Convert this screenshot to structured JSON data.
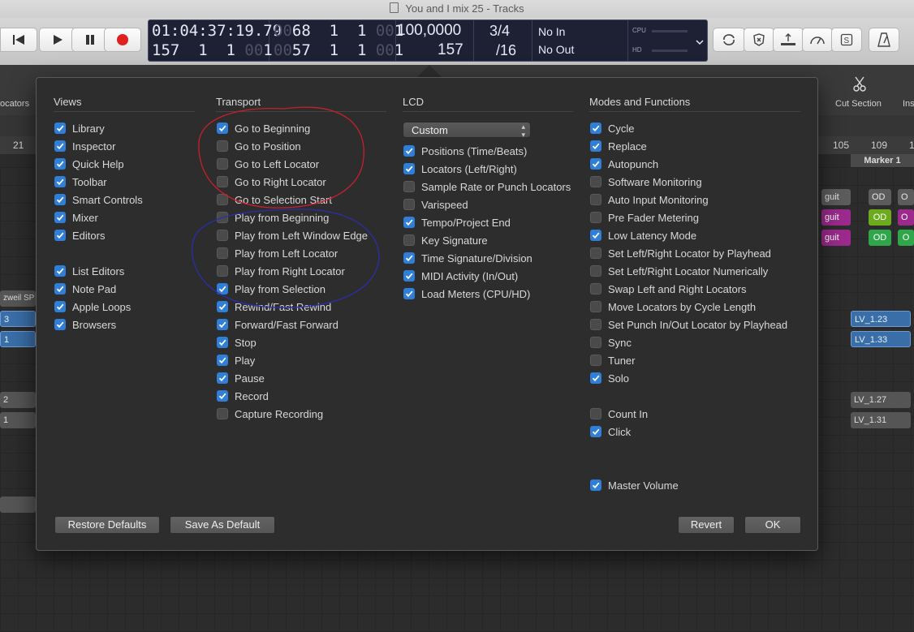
{
  "window": {
    "title": "You and I mix 25 - Tracks"
  },
  "lcd": {
    "time": "01:04:37:19.79",
    "time_dim_1": "00",
    "bars_top": "68  1  1",
    "bars_top_dim": "00",
    "bars_top_tail": "1",
    "row2_left": "157  1  1",
    "row2_left_dim": "00",
    "row2_left_tail": "1",
    "row2_mid_dim": "00",
    "row2_mid": "57  1  1",
    "row2_mid_dim2": "00",
    "row2_mid_tail": "1",
    "row1_dim_left": "00",
    "row1_dim_tail": "00",
    "tempo": "100,0000",
    "tempo_sub": "157",
    "sig_top": "3/4",
    "sig_bottom": "/16",
    "midi_in": "No In",
    "midi_out": "No Out",
    "cpu_label": "CPU",
    "hd_label": "HD"
  },
  "subtoolbar": {
    "left_label": "ocators",
    "cut_section": "Cut Section",
    "ins_label": "Ins"
  },
  "ruler": {
    "n21": "21",
    "n105": "105",
    "n109": "109",
    "n1": "1"
  },
  "arrange": {
    "marker": "Marker 1",
    "zweil": "zweil SP",
    "guit": "guit",
    "od": "OD",
    "o": "O",
    "lv123": "LV_1.23",
    "lv133": "LV_1.33",
    "lv127": "LV_1.27",
    "lv131": "LV_1.31",
    "left_3": "3",
    "left_1": "1",
    "left_2": "2"
  },
  "dialog": {
    "views": {
      "heading": "Views",
      "items": [
        {
          "label": "Library",
          "checked": true
        },
        {
          "label": "Inspector",
          "checked": true
        },
        {
          "label": "Quick Help",
          "checked": true
        },
        {
          "label": "Toolbar",
          "checked": true
        },
        {
          "label": "Smart Controls",
          "checked": true
        },
        {
          "label": "Mixer",
          "checked": true
        },
        {
          "label": "Editors",
          "checked": true
        },
        {
          "label": "List Editors",
          "checked": true
        },
        {
          "label": "Note Pad",
          "checked": true
        },
        {
          "label": "Apple Loops",
          "checked": true
        },
        {
          "label": "Browsers",
          "checked": true
        }
      ]
    },
    "transport": {
      "heading": "Transport",
      "items": [
        {
          "label": "Go to Beginning",
          "checked": true
        },
        {
          "label": "Go to Position",
          "checked": false
        },
        {
          "label": "Go to Left Locator",
          "checked": false
        },
        {
          "label": "Go to Right Locator",
          "checked": false
        },
        {
          "label": "Go to Selection Start",
          "checked": false
        },
        {
          "label": "Play from Beginning",
          "checked": false
        },
        {
          "label": "Play from Left Window Edge",
          "checked": false
        },
        {
          "label": "Play from Left Locator",
          "checked": false
        },
        {
          "label": "Play from Right Locator",
          "checked": false
        },
        {
          "label": "Play from Selection",
          "checked": true
        },
        {
          "label": "Rewind/Fast Rewind",
          "checked": true
        },
        {
          "label": "Forward/Fast Forward",
          "checked": true
        },
        {
          "label": "Stop",
          "checked": true
        },
        {
          "label": "Play",
          "checked": true
        },
        {
          "label": "Pause",
          "checked": true
        },
        {
          "label": "Record",
          "checked": true
        },
        {
          "label": "Capture Recording",
          "checked": false
        }
      ]
    },
    "lcd": {
      "heading": "LCD",
      "select_value": "Custom",
      "items": [
        {
          "label": "Positions (Time/Beats)",
          "checked": true
        },
        {
          "label": "Locators (Left/Right)",
          "checked": true
        },
        {
          "label": "Sample Rate or Punch Locators",
          "checked": false
        },
        {
          "label": "Varispeed",
          "checked": false
        },
        {
          "label": "Tempo/Project End",
          "checked": true
        },
        {
          "label": "Key Signature",
          "checked": false
        },
        {
          "label": "Time Signature/Division",
          "checked": true
        },
        {
          "label": "MIDI Activity (In/Out)",
          "checked": true
        },
        {
          "label": "Load Meters (CPU/HD)",
          "checked": true
        }
      ]
    },
    "modes": {
      "heading": "Modes and Functions",
      "items": [
        {
          "label": "Cycle",
          "checked": true
        },
        {
          "label": "Replace",
          "checked": true
        },
        {
          "label": "Autopunch",
          "checked": true
        },
        {
          "label": "Software Monitoring",
          "checked": false
        },
        {
          "label": "Auto Input Monitoring",
          "checked": false
        },
        {
          "label": "Pre Fader Metering",
          "checked": false
        },
        {
          "label": "Low Latency Mode",
          "checked": true
        },
        {
          "label": "Set Left/Right Locator by Playhead",
          "checked": false
        },
        {
          "label": "Set Left/Right Locator Numerically",
          "checked": false
        },
        {
          "label": "Swap Left and Right Locators",
          "checked": false
        },
        {
          "label": "Move Locators by Cycle Length",
          "checked": false
        },
        {
          "label": "Set Punch In/Out Locator by Playhead",
          "checked": false
        },
        {
          "label": "Sync",
          "checked": false
        },
        {
          "label": "Tuner",
          "checked": false
        },
        {
          "label": "Solo",
          "checked": true
        },
        {
          "label": "Count In",
          "checked": false
        },
        {
          "label": "Click",
          "checked": true
        },
        {
          "label": "Master Volume",
          "checked": true
        }
      ]
    },
    "buttons": {
      "restore": "Restore Defaults",
      "save_default": "Save As Default",
      "revert": "Revert",
      "ok": "OK"
    }
  },
  "colors": {
    "accent": "#2f7fd8",
    "annotation_red": "#c8202a",
    "annotation_blue": "#2a2fa8"
  }
}
